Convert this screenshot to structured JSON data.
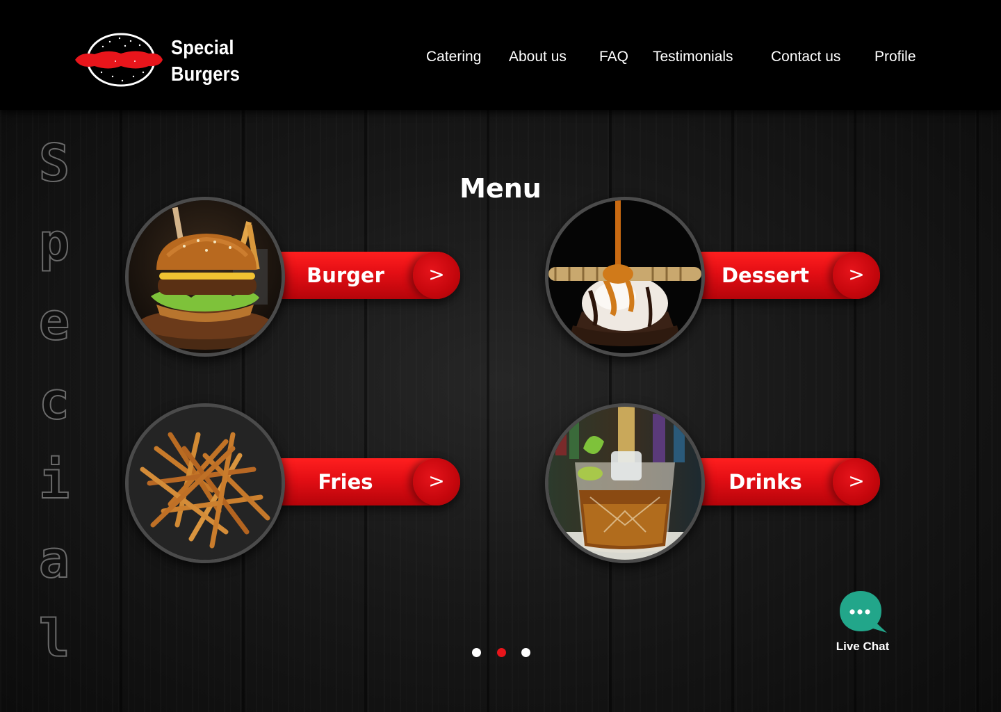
{
  "brand": {
    "line1": "Special",
    "line2": "Burgers",
    "accent": "#e8151b"
  },
  "nav": {
    "items": [
      "Catering",
      "About us",
      "FAQ",
      "Testimonials",
      "Contact us",
      "Profile"
    ]
  },
  "side_word": [
    "S",
    "p",
    "e",
    "c",
    "i",
    "a",
    "l"
  ],
  "menu": {
    "title": "Menu",
    "items": [
      {
        "label": "Burger",
        "arrow": ">",
        "image": "burger-image"
      },
      {
        "label": "Dessert",
        "arrow": ">",
        "image": "dessert-image"
      },
      {
        "label": "Fries",
        "arrow": ">",
        "image": "fries-image"
      },
      {
        "label": "Drinks",
        "arrow": ">",
        "image": "drinks-image"
      }
    ]
  },
  "carousel": {
    "total": 3,
    "active": 2
  },
  "chat": {
    "label": "Live Chat",
    "color": "#22a68a"
  }
}
